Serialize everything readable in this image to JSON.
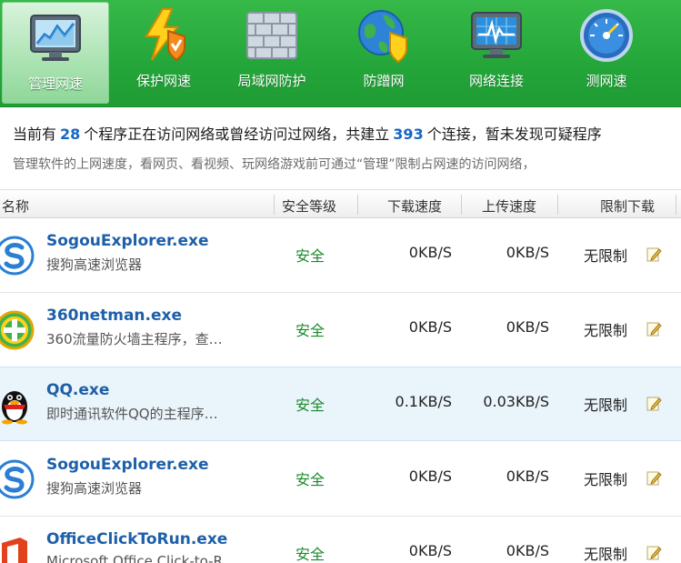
{
  "toolbar": {
    "items": [
      {
        "label": "管理网速",
        "icon": "monitor-chart-icon",
        "active": true
      },
      {
        "label": "保护网速",
        "icon": "lightning-shield-icon",
        "active": false
      },
      {
        "label": "局域网防护",
        "icon": "brick-wall-icon",
        "active": false
      },
      {
        "label": "防蹭网",
        "icon": "globe-shield-icon",
        "active": false
      },
      {
        "label": "网络连接",
        "icon": "network-monitor-icon",
        "active": false
      },
      {
        "label": "测网速",
        "icon": "speedometer-icon",
        "active": false
      }
    ]
  },
  "summary": {
    "prefix": "当前有",
    "program_count": "28",
    "middle": "个程序正在访问网络或曾经访问过网络，共建立",
    "connection_count": "393",
    "suffix": "个连接，暂未发现可疑程序",
    "hint": "管理软件的上网速度，看网页、看视频、玩网络游戏前可通过“管理”限制占网速的访问网络，"
  },
  "table": {
    "columns": {
      "name": "名称",
      "safety": "安全等级",
      "download": "下载速度",
      "upload": "上传速度",
      "limit": "限制下载"
    },
    "rows": [
      {
        "name": "SogouExplorer.exe",
        "desc": "搜狗高速浏览器",
        "safety": "安全",
        "download": "0KB/S",
        "upload": "0KB/S",
        "limit": "无限制",
        "icon": "sogou-icon",
        "selected": false
      },
      {
        "name": "360netman.exe",
        "desc": "360流量防火墙主程序，查…",
        "safety": "安全",
        "download": "0KB/S",
        "upload": "0KB/S",
        "limit": "无限制",
        "icon": "360-icon",
        "selected": false
      },
      {
        "name": "QQ.exe",
        "desc": "即时通讯软件QQ的主程序…",
        "safety": "安全",
        "download": "0.1KB/S",
        "upload": "0.03KB/S",
        "limit": "无限制",
        "icon": "qq-penguin-icon",
        "selected": true
      },
      {
        "name": "SogouExplorer.exe",
        "desc": "搜狗高速浏览器",
        "safety": "安全",
        "download": "0KB/S",
        "upload": "0KB/S",
        "limit": "无限制",
        "icon": "sogou-icon",
        "selected": false
      },
      {
        "name": "OfficeClickToRun.exe",
        "desc": "Microsoft Office Click-to-R…",
        "safety": "安全",
        "download": "0KB/S",
        "upload": "0KB/S",
        "limit": "无限制",
        "icon": "office-icon",
        "selected": false
      }
    ]
  },
  "colors": {
    "toolbar_green": "#2aae3f",
    "link_blue": "#1d5fa8",
    "safe_green": "#1a8a2a",
    "count_blue": "#1666c4",
    "selected_row": "#eaf4fb"
  }
}
